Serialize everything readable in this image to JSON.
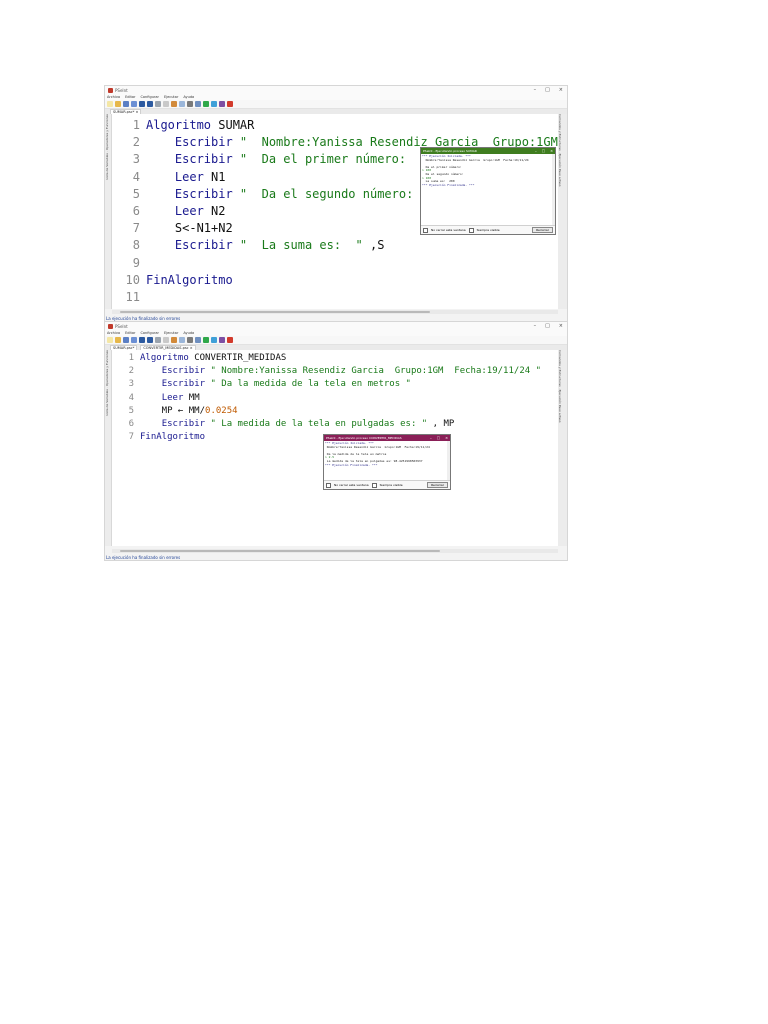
{
  "screenshot1": {
    "window_title": "PSeInt",
    "window_controls": [
      "–",
      "□",
      "×"
    ],
    "menu": [
      "Archivo",
      "Editar",
      "Configurar",
      "Ejecutar",
      "Ayuda"
    ],
    "tab": "SUMAR.psc*",
    "tab_close": "×",
    "left_panel": "Lista de Variables · Operadores y Funciones",
    "right_panel": "Comandos y Estructuras · Ejecución Paso a Paso",
    "code": [
      {
        "n": "1",
        "parts": [
          {
            "t": "kw",
            "v": "Algoritmo"
          },
          {
            "t": "pl",
            "v": " SUMAR"
          }
        ]
      },
      {
        "n": "2",
        "parts": [
          {
            "t": "pl",
            "v": "    "
          },
          {
            "t": "kw",
            "v": "Escribir"
          },
          {
            "t": "str",
            "v": " \"  Nombre:Yanissa Resendiz Garcia  Grupo:1GM"
          }
        ]
      },
      {
        "n": "3",
        "parts": [
          {
            "t": "pl",
            "v": "    "
          },
          {
            "t": "kw",
            "v": "Escribir"
          },
          {
            "t": "str",
            "v": " \"  Da el primer número:  \""
          }
        ]
      },
      {
        "n": "4",
        "parts": [
          {
            "t": "pl",
            "v": "    "
          },
          {
            "t": "kw",
            "v": "Leer"
          },
          {
            "t": "pl",
            "v": " N1"
          }
        ]
      },
      {
        "n": "5",
        "parts": [
          {
            "t": "pl",
            "v": "    "
          },
          {
            "t": "kw",
            "v": "Escribir"
          },
          {
            "t": "str",
            "v": " \"  Da el segundo número:"
          }
        ]
      },
      {
        "n": "6",
        "parts": [
          {
            "t": "pl",
            "v": "    "
          },
          {
            "t": "kw",
            "v": "Leer"
          },
          {
            "t": "pl",
            "v": " N2"
          }
        ]
      },
      {
        "n": "7",
        "parts": [
          {
            "t": "pl",
            "v": "    S<-N1+N2"
          }
        ]
      },
      {
        "n": "8",
        "parts": [
          {
            "t": "pl",
            "v": "    "
          },
          {
            "t": "kw",
            "v": "Escribir"
          },
          {
            "t": "str",
            "v": " \"  La suma es:  \""
          },
          {
            "t": "pl",
            "v": " ,S"
          }
        ]
      },
      {
        "n": "9",
        "parts": []
      },
      {
        "n": "10",
        "parts": [
          {
            "t": "kw",
            "v": "FinAlgoritmo"
          }
        ]
      },
      {
        "n": "11",
        "parts": []
      }
    ],
    "console": {
      "title": "PSeInt - Ejecutando proceso SUMAR",
      "controls": [
        "–",
        "□",
        "×"
      ],
      "lines": [
        {
          "c": "c-hdr",
          "v": "*** Ejecución Iniciada. ***"
        },
        {
          "c": "c-out",
          "v": "  Nombre:Yanissa Resendiz Garcia  Grupo:1GM  Fecha:19/11/24"
        },
        {
          "c": "c-out",
          "v": ""
        },
        {
          "c": "c-out",
          "v": "  Da el primer número:"
        },
        {
          "c": "c-in",
          "v": "> 100"
        },
        {
          "c": "c-out",
          "v": "  Da el segundo número:"
        },
        {
          "c": "c-in",
          "v": "> 100"
        },
        {
          "c": "c-out",
          "v": "  La suma es:  200"
        },
        {
          "c": "c-hdr",
          "v": "*** Ejecución Finalizada. ***"
        }
      ],
      "opt1": "No cerrar esta ventana",
      "opt2": "Siempre visible",
      "button": "Reiniciar"
    },
    "status": "La ejecución ha finalizado sin errores"
  },
  "screenshot2": {
    "window_title": "PSeInt",
    "window_controls": [
      "–",
      "□",
      "×"
    ],
    "menu": [
      "Archivo",
      "Editar",
      "Configurar",
      "Ejecutar",
      "Ayuda"
    ],
    "tabs": [
      "SUMAR.psc*",
      "CONVERTIR_MEDIDAS.psc"
    ],
    "tab_close": "×",
    "left_panel": "Lista de Variables · Operadores y Funciones",
    "right_panel": "Comandos y Estructuras · Ejecución Paso a Paso",
    "code": [
      {
        "n": "1",
        "parts": [
          {
            "t": "kw",
            "v": "Algoritmo"
          },
          {
            "t": "pl",
            "v": " CONVERTIR_MEDIDAS"
          }
        ]
      },
      {
        "n": "2",
        "parts": [
          {
            "t": "pl",
            "v": "    "
          },
          {
            "t": "kw",
            "v": "Escribir"
          },
          {
            "t": "str",
            "v": " \" Nombre:Yanissa Resendiz Garcia  Grupo:1GM  Fecha:19/11/24 \""
          }
        ]
      },
      {
        "n": "3",
        "parts": [
          {
            "t": "pl",
            "v": "    "
          },
          {
            "t": "kw",
            "v": "Escribir"
          },
          {
            "t": "str",
            "v": " \" Da la medida de la tela en metros \""
          }
        ]
      },
      {
        "n": "4",
        "parts": [
          {
            "t": "pl",
            "v": "    "
          },
          {
            "t": "kw",
            "v": "Leer"
          },
          {
            "t": "pl",
            "v": " MM"
          }
        ]
      },
      {
        "n": "5",
        "parts": [
          {
            "t": "pl",
            "v": "    MP ← MM/"
          },
          {
            "t": "num",
            "v": "0.0254"
          }
        ]
      },
      {
        "n": "6",
        "parts": [
          {
            "t": "pl",
            "v": "    "
          },
          {
            "t": "kw",
            "v": "Escribir"
          },
          {
            "t": "str",
            "v": " \" La medida de la tela en pulgadas es: \""
          },
          {
            "t": "pl",
            "v": " , MP"
          }
        ]
      },
      {
        "n": "7",
        "parts": [
          {
            "t": "kw",
            "v": "FinAlgoritmo"
          }
        ]
      }
    ],
    "console": {
      "title": "PSeInt - Ejecutando proceso CONVERTIR_MEDIDAS",
      "controls": [
        "–",
        "□",
        "×"
      ],
      "lines": [
        {
          "c": "c-hdr",
          "v": "*** Ejecución Iniciada. ***"
        },
        {
          "c": "c-out",
          "v": " Nombre:Yanissa Resendiz Garcia  Grupo:1GM  Fecha:19/11/24"
        },
        {
          "c": "c-out",
          "v": ""
        },
        {
          "c": "c-out",
          "v": " Da la medida de la tela en metros"
        },
        {
          "c": "c-in",
          "v": "> 2.5"
        },
        {
          "c": "c-out",
          "v": " La medida de la tela en pulgadas es: 98.4251968503937"
        },
        {
          "c": "c-hdr",
          "v": "*** Ejecución Finalizada. ***"
        }
      ],
      "opt1": "No cerrar esta ventana",
      "opt2": "Siempre visible",
      "button": "Reiniciar"
    },
    "status": "La ejecución ha finalizado sin errores"
  },
  "colors": {
    "keyword": "#1a1a8f",
    "string": "#1a7a1a",
    "number": "#c05a00",
    "console1_titlebar": "#3f7d1f",
    "console2_titlebar": "#8a1f57",
    "status_text": "#1b3e93"
  },
  "toolbar_icons": [
    "new-file-icon",
    "open-folder-icon",
    "save-icon",
    "save-as-icon",
    "undo-icon",
    "redo-icon",
    "cut-icon",
    "copy-icon",
    "paste-icon",
    "indent-icon",
    "search-icon",
    "replace-icon",
    "run-icon",
    "step-icon",
    "flowchart-icon",
    "pseint-icon"
  ]
}
